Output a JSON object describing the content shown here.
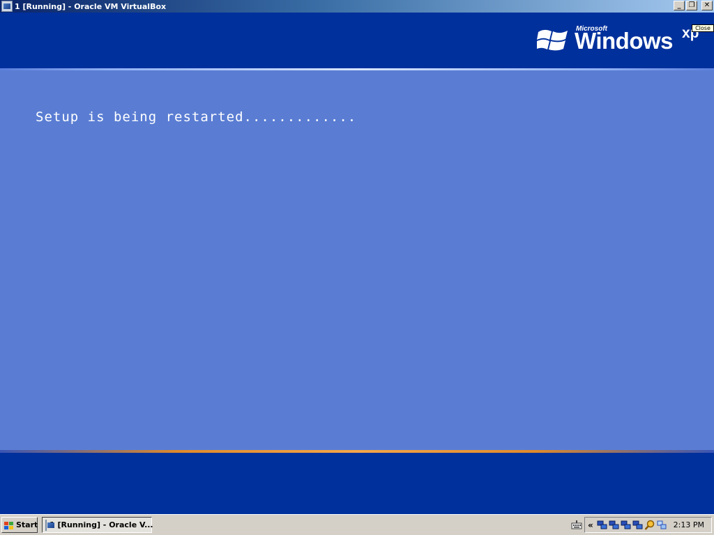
{
  "window": {
    "title": "1 [Running] - Oracle VM VirtualBox",
    "icon": "virtualbox-icon",
    "controls": {
      "minimize": "_",
      "restore": "❐",
      "close": "✕"
    }
  },
  "guest": {
    "logo": {
      "microsoft": "Microsoft",
      "windows": "Windows",
      "suffix": "xp"
    },
    "close_tooltip": "Close",
    "status_text": "Setup is being restarted.............",
    "colors": {
      "top_band": "#00309c",
      "main": "#5a7dd3",
      "bottom_accent": "#f4a64a"
    }
  },
  "taskbar": {
    "start_label": "Start",
    "task_button_label": "1 [Running] - Oracle V...",
    "tray": {
      "chevron": "«",
      "icons": [
        "network-icon",
        "network-icon",
        "network-icon",
        "network-icon",
        "search-icon",
        "display-icon"
      ],
      "clock": "2:13 PM"
    }
  }
}
